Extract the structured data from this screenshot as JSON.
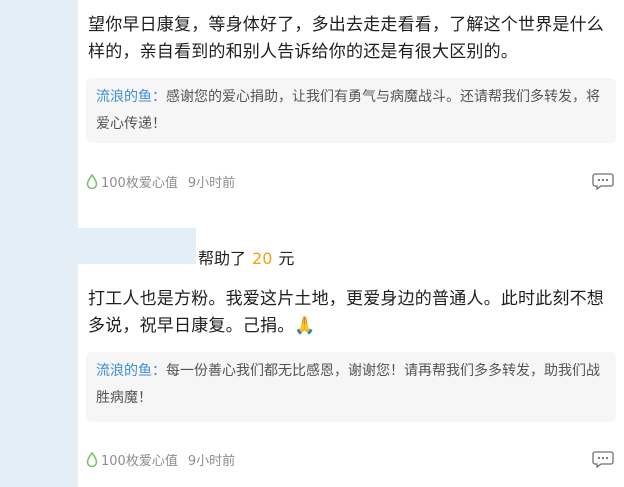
{
  "comments": [
    {
      "text": "望你早日康复，等身体好了，多出去走走看看，了解这个世界是什么样的，亲自看到的和别人告诉给你的还是有很大区别的。",
      "reply": {
        "name": "流浪的鱼：",
        "text": "感谢您的爱心捐助，让我们有勇气与病魔战斗。还请帮我们多转发，将爱心传递！"
      },
      "love_value": "100枚爱心值",
      "time": "9小时前"
    },
    {
      "donation": {
        "prefix": "帮助了",
        "amount": "20",
        "unit": "元"
      },
      "text": "打工人也是方粉。我爱这片土地，更爱身边的普通人。此时此刻不想多说，祝早日康复。己捐。🙏",
      "reply": {
        "name": "流浪的鱼：",
        "text": "每一份善心我们都无比感恩，谢谢您！请再帮我们多多转发，助我们战胜病魔！"
      },
      "love_value": "100枚爱心值",
      "time": "9小时前"
    }
  ],
  "icons": {
    "love": "water-drop-icon",
    "comment": "comment-bubble-icon"
  },
  "colors": {
    "accent": "#3c8fd6",
    "amount": "#f2a20f",
    "drop": "#7cc46a"
  }
}
